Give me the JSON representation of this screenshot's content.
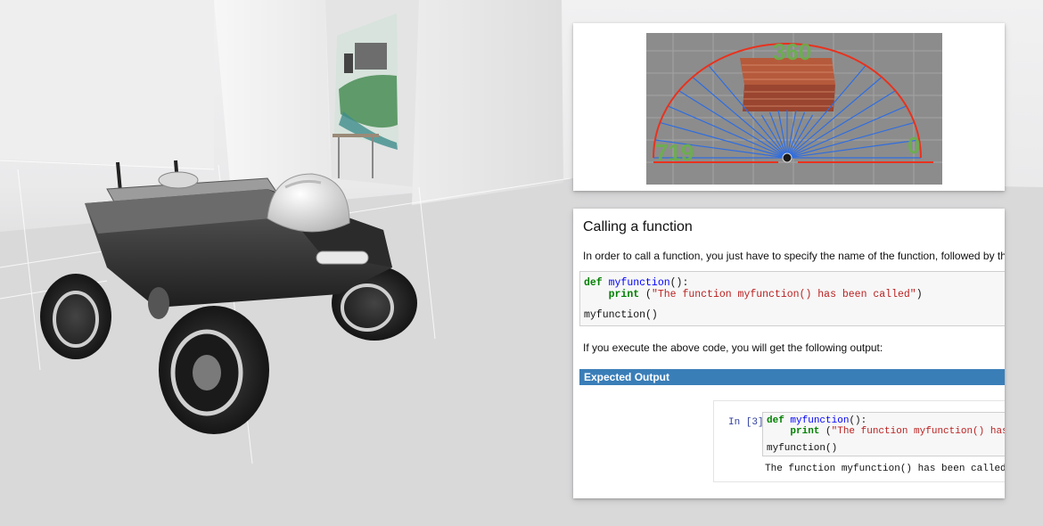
{
  "laser_view": {
    "angle_labels": {
      "top": "360",
      "left": "719",
      "right": "0"
    },
    "colors": {
      "rays": "#2f6de0",
      "arc": "#e8321e",
      "labels": "#6ab04c"
    }
  },
  "notebook": {
    "title": "Calling a function",
    "intro": "In order to call a function, you just have to specify the name of the function, followed by the open and cl",
    "code": {
      "def_kw": "def",
      "fn_name": "myfunction",
      "def_tail": "():",
      "print_kw": "print",
      "print_open": " (",
      "print_str": "\"The function myfunction() has been called\"",
      "print_close": ")",
      "call": "myfunction()"
    },
    "after_code": "If you execute the above code, you will get the following output:",
    "expected_output_label": "Expected Output",
    "cell": {
      "prompt": "In [3]:",
      "def_kw": "def",
      "fn_name": "myfunction",
      "def_tail": "():",
      "print_kw": "print",
      "print_open": " (",
      "print_str": "\"The function myfunction() has been",
      "call": "myfunction()",
      "output": "The function myfunction() has been called"
    }
  }
}
